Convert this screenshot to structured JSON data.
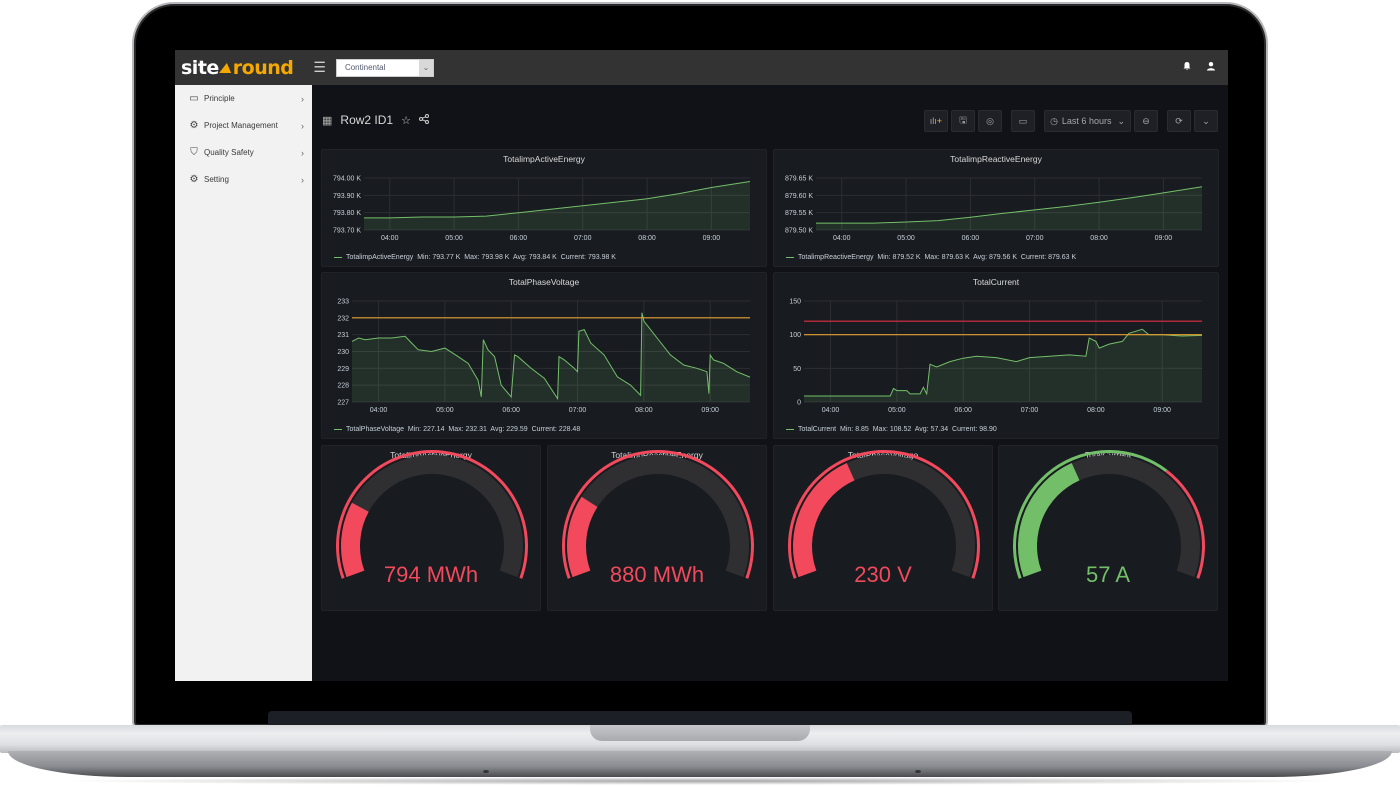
{
  "topbar": {
    "logo_left": "site",
    "logo_right": "round",
    "menu_icon": "hamburger-icon",
    "site_select": {
      "value": "Continental"
    },
    "icons": [
      "bell-icon",
      "user-icon"
    ]
  },
  "sidebar": {
    "items": [
      {
        "label": "Principle",
        "icon": "id-card-icon"
      },
      {
        "label": "Project Management",
        "icon": "cogs-icon"
      },
      {
        "label": "Quality Safety",
        "icon": "shield-icon"
      },
      {
        "label": "Setting",
        "icon": "gear-icon"
      }
    ]
  },
  "dashboard": {
    "title": "Row2 ID1",
    "toolbar": {
      "time_range": "Last 6 hours",
      "buttons": [
        "add-panel-icon",
        "save-icon",
        "settings-icon",
        "tv-mode-icon",
        "clock-icon",
        "zoom-out-icon",
        "refresh-icon",
        "chevron-down-icon"
      ]
    }
  },
  "colors": {
    "series": "#73bf69",
    "threshold_orange": "#e5a02f",
    "threshold_red": "#e02f44",
    "gauge_red": "#f2495c",
    "gauge_green": "#73bf69",
    "gauge_track": "#2f2f32"
  },
  "chart_data": [
    {
      "type": "area",
      "title": "TotalimpActiveEnergy",
      "x_ticks": [
        "04:00",
        "05:00",
        "06:00",
        "07:00",
        "08:00",
        "09:00"
      ],
      "y_ticks": [
        "793.70 K",
        "793.80 K",
        "793.90 K",
        "794.00 K"
      ],
      "ylim": [
        793.7,
        794.0
      ],
      "x": [
        3.6,
        4.0,
        4.5,
        5.0,
        5.5,
        6.0,
        6.5,
        7.0,
        7.5,
        8.0,
        8.5,
        9.0,
        9.6
      ],
      "values": [
        793.77,
        793.77,
        793.775,
        793.775,
        793.78,
        793.8,
        793.82,
        793.84,
        793.86,
        793.88,
        793.91,
        793.945,
        793.98
      ],
      "legend": {
        "name": "TotalimpActiveEnergy",
        "min": "793.77 K",
        "max": "793.98 K",
        "avg": "793.84 K",
        "current": "793.98 K"
      },
      "thresholds": []
    },
    {
      "type": "area",
      "title": "TotalimpReactiveEnergy",
      "x_ticks": [
        "04:00",
        "05:00",
        "06:00",
        "07:00",
        "08:00",
        "09:00"
      ],
      "y_ticks": [
        "879.50 K",
        "879.55 K",
        "879.60 K",
        "879.65 K"
      ],
      "ylim": [
        879.5,
        879.65
      ],
      "x": [
        3.6,
        4.0,
        4.5,
        5.0,
        5.5,
        6.0,
        6.5,
        7.0,
        7.5,
        8.0,
        8.5,
        9.0,
        9.6
      ],
      "values": [
        879.52,
        879.52,
        879.52,
        879.523,
        879.527,
        879.537,
        879.548,
        879.558,
        879.568,
        879.58,
        879.593,
        879.607,
        879.625
      ],
      "legend": {
        "name": "TotalimpReactiveEnergy",
        "min": "879.52 K",
        "max": "879.63 K",
        "avg": "879.56 K",
        "current": "879.63 K"
      },
      "thresholds": []
    },
    {
      "type": "area",
      "title": "TotalPhaseVoltage",
      "x_ticks": [
        "04:00",
        "05:00",
        "06:00",
        "07:00",
        "08:00",
        "09:00"
      ],
      "y_ticks": [
        "227",
        "228",
        "229",
        "230",
        "231",
        "232",
        "233"
      ],
      "ylim": [
        227,
        233
      ],
      "x": [
        3.6,
        3.7,
        3.8,
        4.0,
        4.2,
        4.4,
        4.5,
        4.6,
        4.8,
        5.0,
        5.2,
        5.35,
        5.5,
        5.55,
        5.58,
        5.65,
        5.75,
        5.85,
        6.0,
        6.05,
        6.1,
        6.3,
        6.5,
        6.7,
        6.72,
        6.8,
        6.95,
        7.0,
        7.02,
        7.1,
        7.2,
        7.4,
        7.6,
        7.8,
        7.95,
        7.97,
        8.0,
        8.1,
        8.2,
        8.4,
        8.6,
        8.8,
        8.95,
        8.98,
        9.0,
        9.05,
        9.2,
        9.4,
        9.6
      ],
      "values": [
        230.6,
        230.8,
        230.7,
        230.8,
        230.8,
        230.9,
        230.5,
        230.1,
        230.0,
        230.2,
        229.7,
        229.3,
        228.3,
        227.3,
        230.7,
        230.1,
        229.7,
        228.0,
        227.3,
        229.8,
        229.7,
        229.0,
        228.4,
        227.2,
        229.7,
        229.5,
        229.0,
        228.8,
        231.2,
        231.3,
        230.5,
        229.8,
        228.5,
        228.0,
        227.4,
        232.3,
        231.8,
        231.3,
        230.8,
        229.8,
        229.2,
        229.0,
        228.8,
        227.5,
        229.8,
        229.5,
        229.3,
        228.8,
        228.48
      ],
      "legend": {
        "name": "TotalPhaseVoltage",
        "min": "227.14",
        "max": "232.31",
        "avg": "229.59",
        "current": "228.48"
      },
      "thresholds": [
        {
          "value": 232,
          "color": "orange"
        }
      ]
    },
    {
      "type": "area",
      "title": "TotalCurrent",
      "x_ticks": [
        "04:00",
        "05:00",
        "06:00",
        "07:00",
        "08:00",
        "09:00"
      ],
      "y_ticks": [
        "0",
        "50",
        "100",
        "150"
      ],
      "ylim": [
        0,
        150
      ],
      "x": [
        3.6,
        4.9,
        4.95,
        5.0,
        5.15,
        5.2,
        5.35,
        5.4,
        5.45,
        5.5,
        5.6,
        5.8,
        6.0,
        6.2,
        6.5,
        6.8,
        7.0,
        7.3,
        7.6,
        7.85,
        7.9,
        8.0,
        8.05,
        8.2,
        8.4,
        8.5,
        8.7,
        8.8,
        9.0,
        9.3,
        9.6
      ],
      "values": [
        8.85,
        8.85,
        20,
        17,
        17,
        12,
        12,
        22,
        12,
        56,
        52,
        60,
        65,
        68,
        66,
        60,
        66,
        68,
        70,
        68,
        95,
        90,
        80,
        86,
        90,
        102,
        108,
        100,
        100,
        98,
        98.9
      ],
      "legend": {
        "name": "TotalCurrent",
        "min": "8.85",
        "max": "108.52",
        "avg": "57.34",
        "current": "98.90"
      },
      "thresholds": [
        {
          "value": 120,
          "color": "red"
        },
        {
          "value": 100,
          "color": "orange"
        }
      ]
    }
  ],
  "gauges": [
    {
      "title": "TotalimpActiveEnergy",
      "value_text": "794 MWh",
      "fraction": 0.22,
      "color": "red",
      "threshold_arc": [
        {
          "to": 1.0,
          "color": "red"
        }
      ]
    },
    {
      "title": "TotalimpReactiveEnergy",
      "value_text": "880 MWh",
      "fraction": 0.24,
      "color": "red",
      "threshold_arc": [
        {
          "to": 1.0,
          "color": "red"
        }
      ]
    },
    {
      "title": "TotalPhaseVoltage",
      "value_text": "230 V",
      "fraction": 0.39,
      "color": "red",
      "threshold_arc": [
        {
          "to": 1.0,
          "color": "red"
        }
      ]
    },
    {
      "title": "TotalCurrent",
      "value_text": "57 A",
      "fraction": 0.39,
      "color": "green",
      "threshold_arc": [
        {
          "to": 0.67,
          "color": "green"
        },
        {
          "to": 1.0,
          "color": "red"
        }
      ]
    }
  ]
}
